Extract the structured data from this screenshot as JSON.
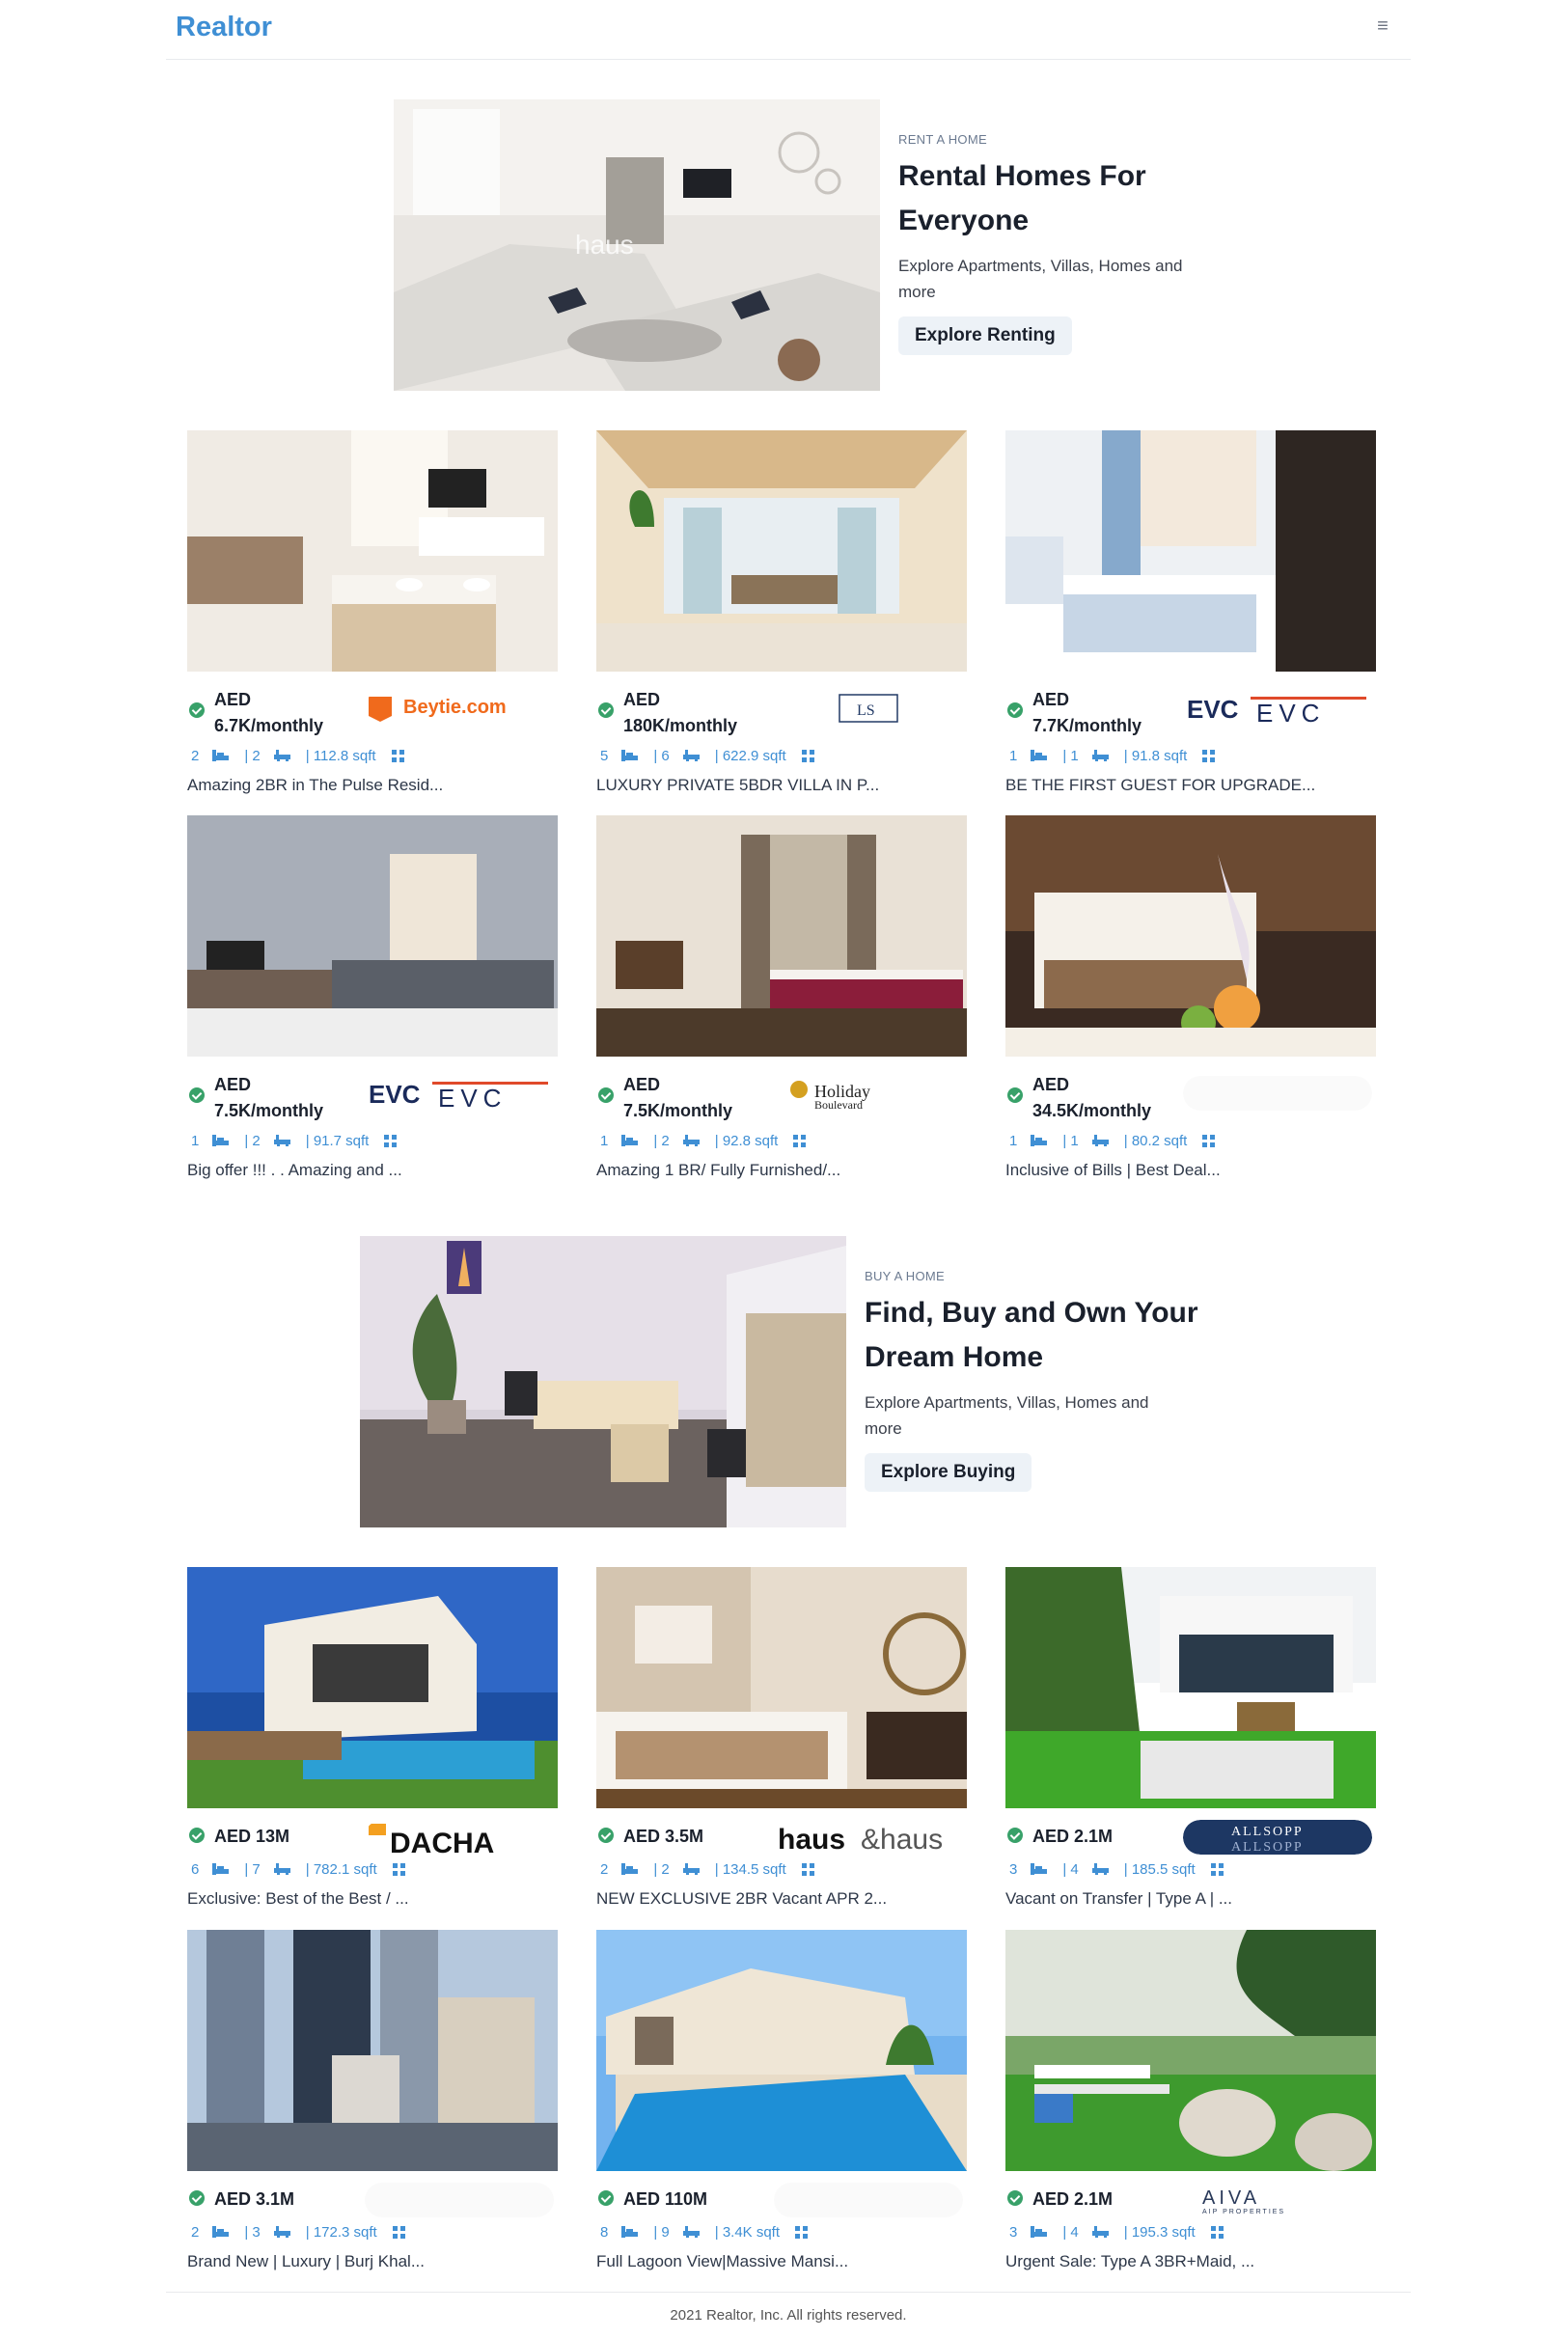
{
  "app": {
    "logo": "Realtor"
  },
  "nav": {
    "menu_icon": "hamburger-icon"
  },
  "banners": [
    {
      "label": "RENT A HOME",
      "title": "Rental Homes For Everyone",
      "desc": "Explore Apartments, Villas, Homes and more",
      "button": "Explore Renting"
    },
    {
      "label": "BUY A HOME",
      "title": "Find, Buy and Own Your Dream Home",
      "desc": "Explore Apartments, Villas, Homes and more",
      "button": "Explore Buying"
    }
  ],
  "rent_listings": [
    {
      "price": "AED 6.7K/monthly",
      "rooms": "2",
      "baths": "| 2",
      "area": "| 112.8 sqft",
      "title": "Amazing 2BR in The Pulse Resid...",
      "agency": "Beytie.com"
    },
    {
      "price": "AED 180K/monthly",
      "rooms": "5",
      "baths": "| 6",
      "area": "| 622.9 sqft",
      "title": "LUXURY PRIVATE 5BDR VILLA IN P...",
      "agency": "LS"
    },
    {
      "price": "AED 7.7K/monthly",
      "rooms": "1",
      "baths": "| 1",
      "area": "| 91.8 sqft",
      "title": "BE THE FIRST GUEST FOR UPGRADE...",
      "agency": "EVC"
    },
    {
      "price": "AED 7.5K/monthly",
      "rooms": "1",
      "baths": "| 2",
      "area": "| 91.7 sqft",
      "title": "Big offer !!! . . Amazing and ...",
      "agency": "EVC"
    },
    {
      "price": "AED 7.5K/monthly",
      "rooms": "1",
      "baths": "| 2",
      "area": "| 92.8 sqft",
      "title": "Amazing 1 BR/ Fully Furnished/...",
      "agency": "Holiday Boulevard"
    },
    {
      "price": "AED 34.5K/monthly",
      "rooms": "1",
      "baths": "| 1",
      "area": "| 80.2 sqft",
      "title": "Inclusive of Bills | Best Deal...",
      "agency": ""
    }
  ],
  "sale_listings": [
    {
      "price": "AED 13M",
      "rooms": "6",
      "baths": "| 7",
      "area": "| 782.1 sqft",
      "title": "Exclusive: Best of the Best / ...",
      "agency": "DACHA"
    },
    {
      "price": "AED 3.5M",
      "rooms": "2",
      "baths": "| 2",
      "area": "| 134.5 sqft",
      "title": "NEW EXCLUSIVE 2BR Vacant APR 2...",
      "agency": "haus&haus"
    },
    {
      "price": "AED 2.1M",
      "rooms": "3",
      "baths": "| 4",
      "area": "| 185.5 sqft",
      "title": "Vacant on Transfer | Type A | ...",
      "agency": "ALLSOPP & ALLSOPP"
    },
    {
      "price": "AED 3.1M",
      "rooms": "2",
      "baths": "| 3",
      "area": "| 172.3 sqft",
      "title": "Brand New | Luxury | Burj Khal...",
      "agency": ""
    },
    {
      "price": "AED 110M",
      "rooms": "8",
      "baths": "| 9",
      "area": "| 3.4K sqft",
      "title": "Full Lagoon View|Massive Mansi...",
      "agency": ""
    },
    {
      "price": "AED 2.1M",
      "rooms": "3",
      "baths": "| 4",
      "area": "| 195.3 sqft",
      "title": "Urgent Sale: Type A 3BR+Maid, ...",
      "agency": "AIVA AIP PROPERTIES"
    }
  ],
  "footer": {
    "text": "2021 Realtor, Inc. All rights reserved."
  }
}
